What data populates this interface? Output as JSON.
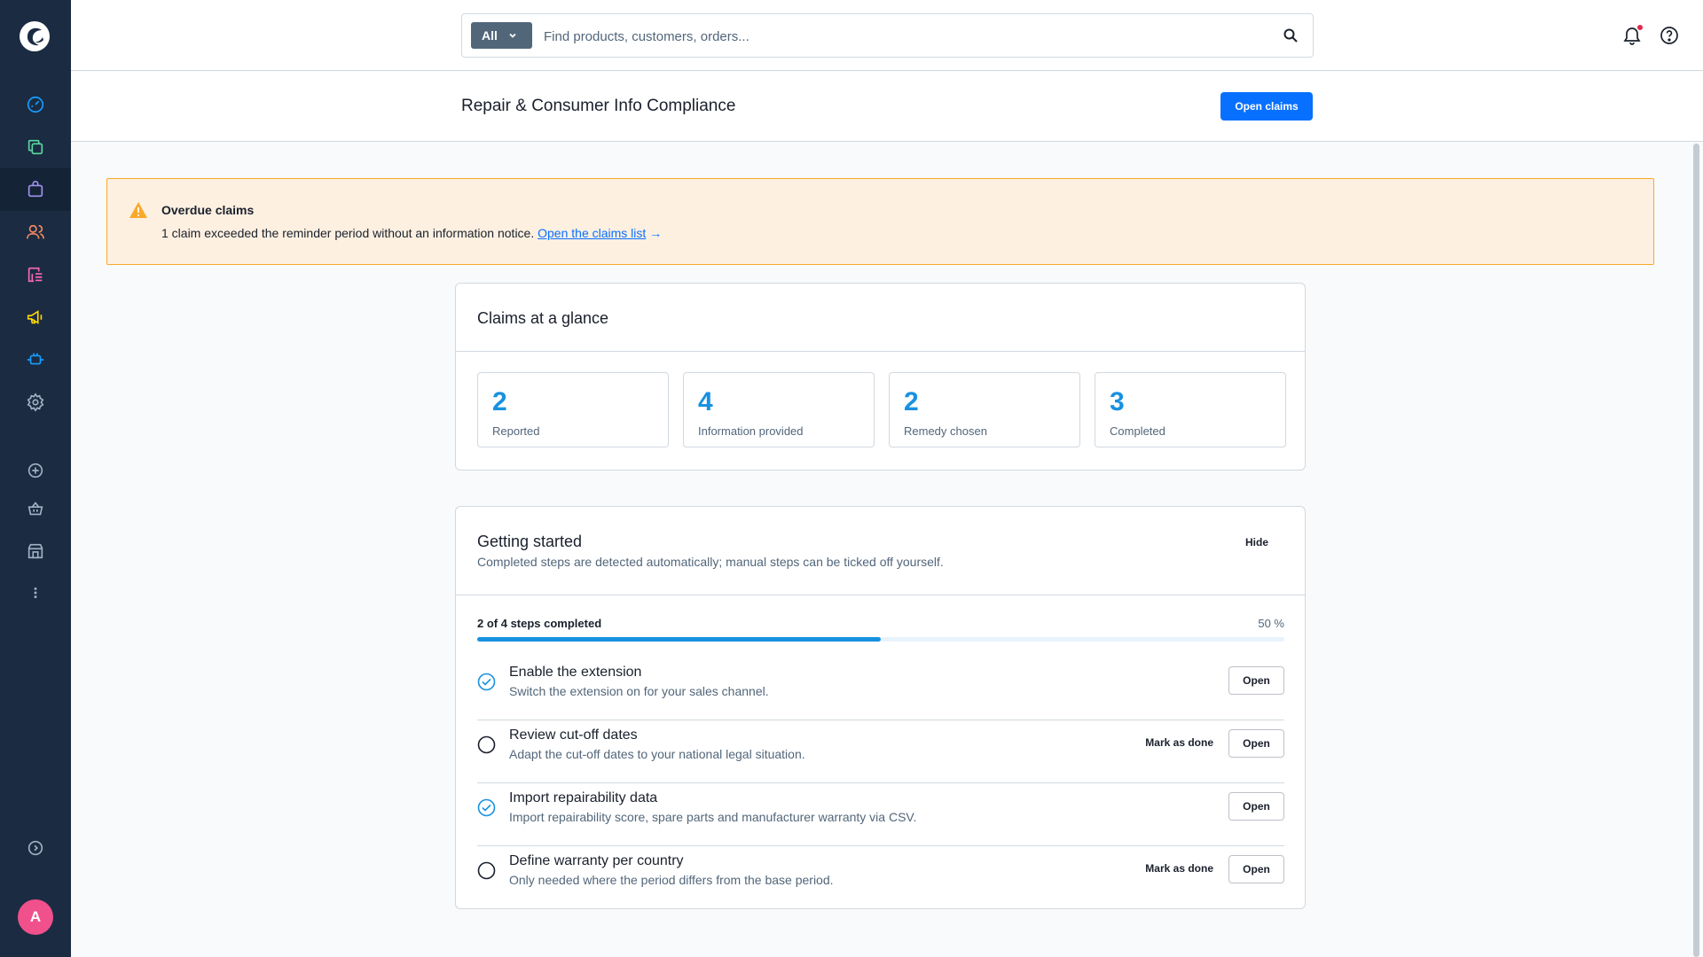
{
  "colors": {
    "sidebar_bg": "#1b2c42",
    "primary": "#0870ff",
    "accent": "#1891e0",
    "alert_bg": "#fdf0e1",
    "alert_border": "#f9a929",
    "avatar": "#f0508c"
  },
  "sidebar": {
    "logo_icon": "shopware-logo-icon",
    "items": [
      {
        "icon": "dashboard-icon",
        "active": false
      },
      {
        "icon": "catalogue-icon",
        "active": false
      },
      {
        "icon": "orders-icon",
        "active": true
      },
      {
        "icon": "customers-icon",
        "active": false
      },
      {
        "icon": "content-icon",
        "active": false
      },
      {
        "icon": "marketing-icon",
        "active": false
      },
      {
        "icon": "extensions-icon",
        "active": false
      },
      {
        "icon": "settings-icon",
        "active": false
      },
      {
        "icon": "add-sales-channel-icon",
        "active": false
      },
      {
        "icon": "storefront-basket-icon",
        "active": false
      },
      {
        "icon": "shop-building-icon",
        "active": false
      },
      {
        "icon": "more-icon",
        "active": false
      },
      {
        "icon": "collapse-menu-icon",
        "active": false
      }
    ],
    "avatar_initial": "A"
  },
  "topbar": {
    "search_type": "All",
    "search_placeholder": "Find products, customers, orders..."
  },
  "header": {
    "title": "Repair & Consumer Info Compliance",
    "primary_action": "Open claims"
  },
  "alert": {
    "title": "Overdue claims",
    "text": "1 claim exceeded the reminder period without an information notice.",
    "link": "Open the claims list",
    "arrow": "→"
  },
  "glance": {
    "title": "Claims at a glance",
    "stats": [
      {
        "value": "2",
        "label": "Reported"
      },
      {
        "value": "4",
        "label": "Information provided"
      },
      {
        "value": "2",
        "label": "Remedy chosen"
      },
      {
        "value": "3",
        "label": "Completed"
      }
    ]
  },
  "getting_started": {
    "title": "Getting started",
    "subtitle": "Completed steps are detected automatically; manual steps can be ticked off yourself.",
    "hide_label": "Hide",
    "progress_label": "2 of 4 steps completed",
    "progress_percent": "50 %",
    "progress_fraction": 0.5,
    "mark_done_label": "Mark as done",
    "open_label": "Open",
    "steps": [
      {
        "title": "Enable the extension",
        "desc": "Switch the extension on for your sales channel.",
        "done": true
      },
      {
        "title": "Review cut-off dates",
        "desc": "Adapt the cut-off dates to your national legal situation.",
        "done": false
      },
      {
        "title": "Import repairability data",
        "desc": "Import repairability score, spare parts and manufacturer warranty via CSV.",
        "done": true
      },
      {
        "title": "Define warranty per country",
        "desc": "Only needed where the period differs from the base period.",
        "done": false
      }
    ]
  }
}
